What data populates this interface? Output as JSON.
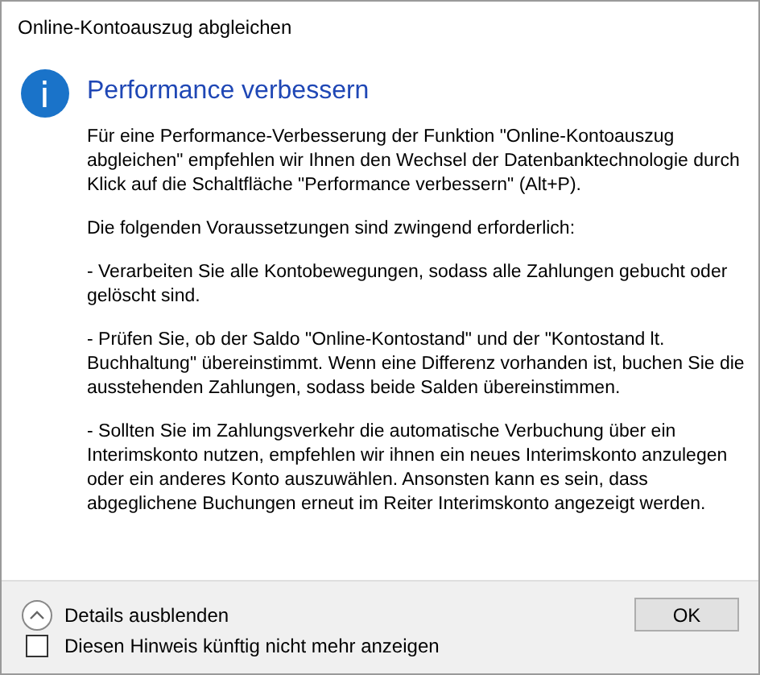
{
  "window": {
    "title": "Online-Kontoauszug abgleichen"
  },
  "heading": "Performance verbessern",
  "paragraphs": [
    "Für eine Performance-Verbesserung der Funktion \"Online-Kontoauszug abgleichen\" empfehlen wir Ihnen den Wechsel der Datenbanktechnologie durch Klick auf die Schaltfläche \"Performance verbessern\" (Alt+P).",
    "Die folgenden Voraussetzungen sind zwingend erforderlich:",
    "- Verarbeiten Sie alle Kontobewegungen, sodass alle Zahlungen gebucht oder gelöscht sind.",
    "- Prüfen Sie, ob der Saldo \"Online-Kontostand\" und der \"Kontostand lt. Buchhaltung\" übereinstimmt. Wenn eine Differenz vorhanden ist, buchen Sie die ausstehenden Zahlungen, sodass beide Salden übereinstimmen.",
    "- Sollten Sie im Zahlungsverkehr die automatische Verbuchung über ein Interimskonto nutzen, empfehlen wir ihnen ein neues Interimskonto anzulegen oder ein anderes Konto auszuwählen. Ansonsten kann es sein, dass abgeglichene Buchungen erneut im Reiter Interimskonto angezeigt werden."
  ],
  "details": {
    "label": "Details ausblenden",
    "expanded": true
  },
  "checkbox": {
    "label": "Diesen Hinweis künftig nicht mehr anzeigen",
    "checked": false
  },
  "buttons": [
    "OK"
  ]
}
